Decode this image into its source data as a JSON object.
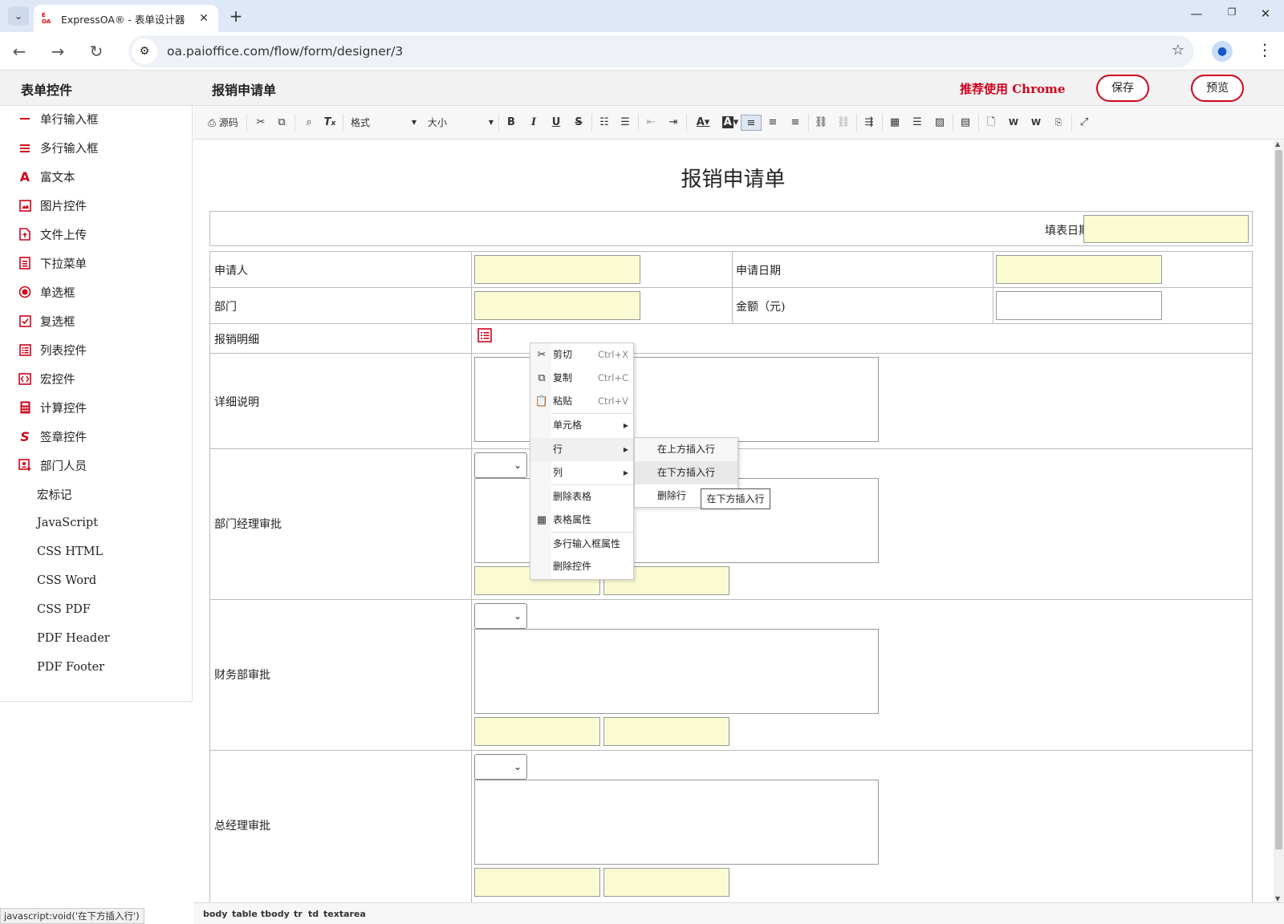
{
  "browser": {
    "tab_title": "ExpressOA® - 表单设计器",
    "favicon_text": "E OA",
    "url": "oa.paioffice.com/flow/form/designer/3",
    "status_url": "javascript:void('在下方插入行')"
  },
  "header": {
    "panel_title": "表单控件",
    "form_title": "报销申请单",
    "recommend": "推荐使用 Chrome",
    "save_label": "保存",
    "preview_label": "预览"
  },
  "sidebar": {
    "items": [
      {
        "label": "单行输入框",
        "icon": "single-line-icon"
      },
      {
        "label": "多行输入框",
        "icon": "multi-line-icon"
      },
      {
        "label": "富文本",
        "icon": "rich-text-icon"
      },
      {
        "label": "图片控件",
        "icon": "image-icon"
      },
      {
        "label": "文件上传",
        "icon": "file-upload-icon"
      },
      {
        "label": "下拉菜单",
        "icon": "dropdown-icon"
      },
      {
        "label": "单选框",
        "icon": "radio-icon"
      },
      {
        "label": "复选框",
        "icon": "checkbox-icon"
      },
      {
        "label": "列表控件",
        "icon": "list-icon"
      },
      {
        "label": "宏控件",
        "icon": "macro-icon"
      },
      {
        "label": "计算控件",
        "icon": "calculator-icon"
      },
      {
        "label": "签章控件",
        "icon": "signature-icon"
      },
      {
        "label": "部门人员",
        "icon": "department-user-icon"
      }
    ],
    "plain_items": [
      "宏标记",
      "JavaScript",
      "CSS HTML",
      "CSS Word",
      "CSS PDF",
      "PDF Header",
      "PDF Footer"
    ]
  },
  "toolbar": {
    "source_label": "源码",
    "format_label": "格式",
    "size_label": "大小"
  },
  "document": {
    "title": "报销申请单",
    "fill_date_label": "填表日期:",
    "applicant_label": "申请人",
    "apply_date_label": "申请日期",
    "department_label": "部门",
    "amount_label": "金额（元)",
    "detail_list_label": "报销明细",
    "description_label": "详细说明",
    "dept_manager_label": "部门经理审批",
    "finance_label": "财务部审批",
    "gm_label": "总经理审批"
  },
  "statusbar": {
    "path": [
      "body",
      "table",
      "tbody",
      "tr",
      "td",
      "textarea"
    ]
  },
  "context_menu": {
    "cut": {
      "label": "剪切",
      "shortcut": "Ctrl+X"
    },
    "copy": {
      "label": "复制",
      "shortcut": "Ctrl+C"
    },
    "paste": {
      "label": "粘贴",
      "shortcut": "Ctrl+V"
    },
    "cell": "单元格",
    "row": "行",
    "column": "列",
    "delete_table": "删除表格",
    "table_props": "表格属性",
    "textarea_props": "多行输入框属性",
    "delete_control": "删除控件"
  },
  "row_submenu": {
    "insert_above": "在上方插入行",
    "insert_below": "在下方插入行",
    "delete_row": "删除行"
  },
  "tooltip": "在下方插入行",
  "colors": {
    "accent": "#d0021b",
    "field_fill": "#fbfbd3"
  }
}
